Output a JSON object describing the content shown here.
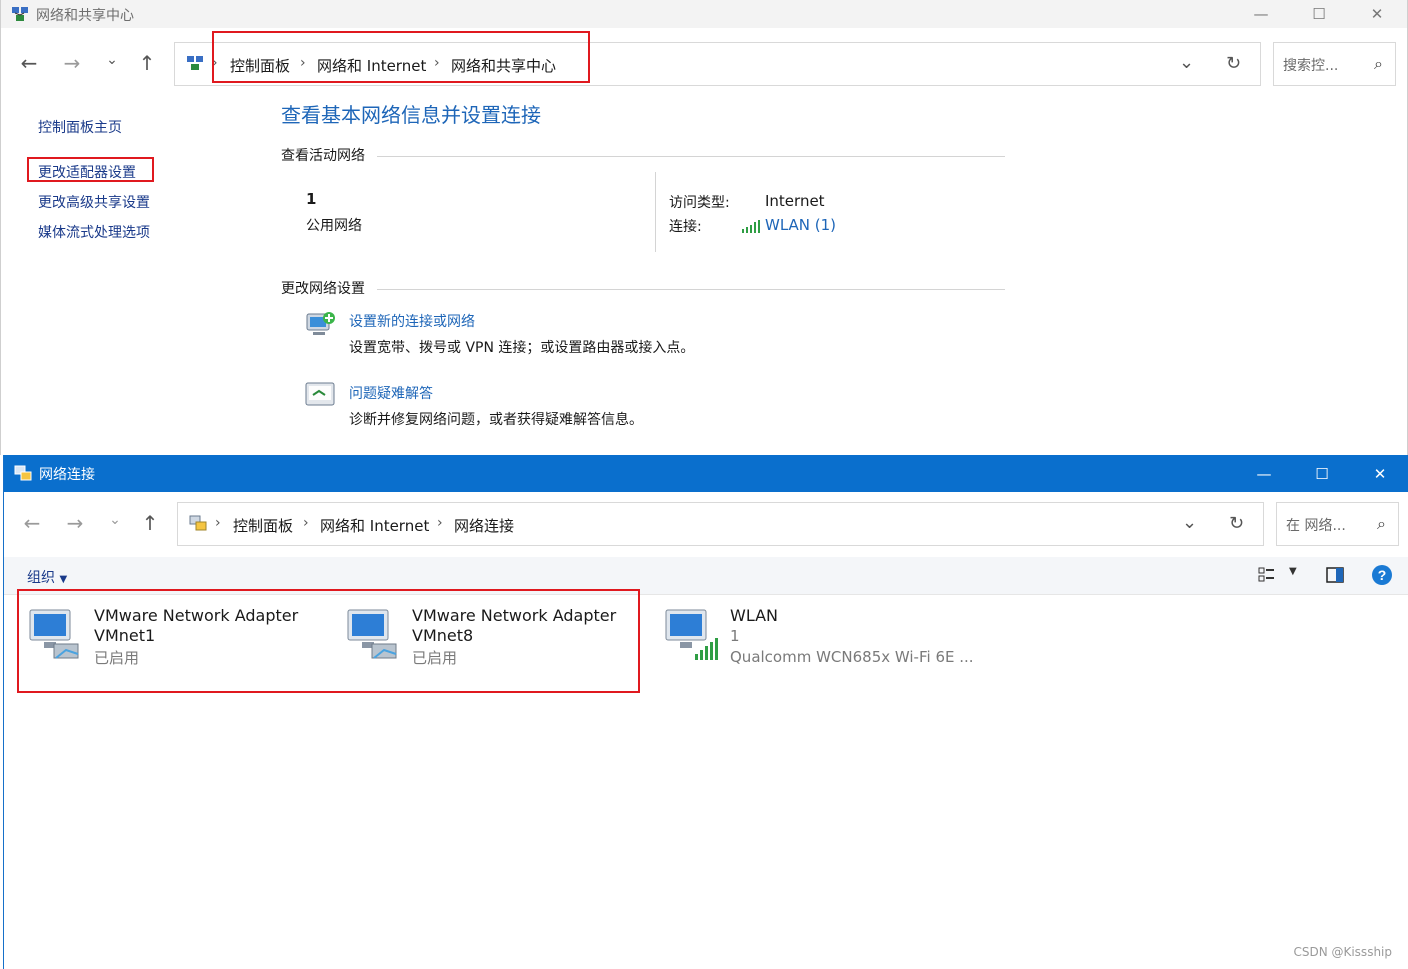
{
  "win1": {
    "title": "网络和共享中心",
    "breadcrumb": [
      "控制面板",
      "网络和 Internet",
      "网络和共享中心"
    ],
    "search_placeholder": "搜索控...",
    "sidebar": {
      "items": [
        {
          "label": "控制面板主页"
        },
        {
          "label": "更改适配器设置"
        },
        {
          "label": "更改高级共享设置"
        },
        {
          "label": "媒体流式处理选项"
        }
      ]
    },
    "main": {
      "title": "查看基本网络信息并设置连接",
      "active_networks_label": "查看活动网络",
      "network": {
        "name": "1",
        "type": "公用网络",
        "access_type_label": "访问类型:",
        "access_type_value": "Internet",
        "connection_label": "连接:",
        "connection_value": "WLAN (1)"
      },
      "change_settings_label": "更改网络设置",
      "tasks": [
        {
          "title": "设置新的连接或网络",
          "desc": "设置宽带、拨号或 VPN 连接；或设置路由器或接入点。"
        },
        {
          "title": "问题疑难解答",
          "desc": "诊断并修复网络问题，或者获得疑难解答信息。"
        }
      ]
    }
  },
  "win2": {
    "title": "网络连接",
    "breadcrumb": [
      "控制面板",
      "网络和 Internet",
      "网络连接"
    ],
    "search_placeholder": "在 网络...",
    "toolbar": {
      "organize_label": "组织"
    },
    "adapters": [
      {
        "name1": "VMware Network Adapter",
        "name2": "VMnet1",
        "status": "已启用"
      },
      {
        "name1": "VMware Network Adapter",
        "name2": "VMnet8",
        "status": "已启用"
      },
      {
        "name1": "WLAN",
        "name2": "1",
        "status": "Qualcomm WCN685x Wi-Fi 6E ..."
      }
    ]
  },
  "watermark": "CSDN @Kissship",
  "colors": {
    "link": "#1e66b8",
    "highlight": "#e0191f",
    "titlebar_active": "#0a6fcd"
  }
}
